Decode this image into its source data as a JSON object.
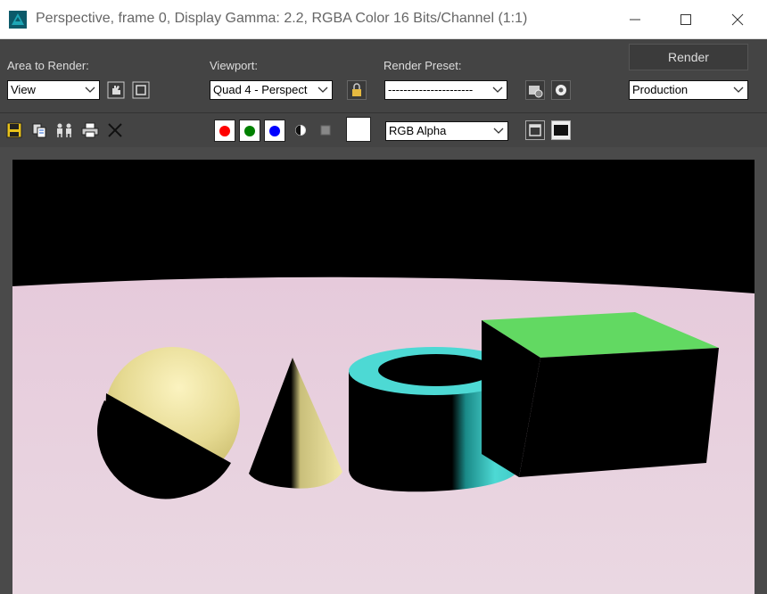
{
  "window": {
    "title": "Perspective, frame 0, Display Gamma: 2.2, RGBA Color 16 Bits/Channel (1:1)",
    "app_icon": "3ds-max-icon",
    "controls": [
      "minimize-icon",
      "maximize-icon",
      "close-icon"
    ]
  },
  "toolbar": {
    "area_to_render_label": "Area to Render:",
    "area_to_render_value": "View",
    "viewport_label": "Viewport:",
    "viewport_value": "Quad 4 - Perspect",
    "render_preset_label": "Render Preset:",
    "render_preset_value": "----------------------",
    "render_button": "Render",
    "production_value": "Production",
    "channel_display_value": "RGB Alpha"
  },
  "channels": [
    {
      "name": "red",
      "color": "#ff0000"
    },
    {
      "name": "green",
      "color": "#008000"
    },
    {
      "name": "blue",
      "color": "#0000ff"
    }
  ],
  "colors": {
    "background": "#444444",
    "titlebar": "#ffffff",
    "render_bg_top": "#000000",
    "floor": "#e8d5e0",
    "yellow_object": "#ede29a",
    "cyan_object": "#4dd9d4",
    "box_top": "#62d962"
  },
  "scene_objects": [
    "sphere",
    "cone",
    "tube",
    "box"
  ]
}
